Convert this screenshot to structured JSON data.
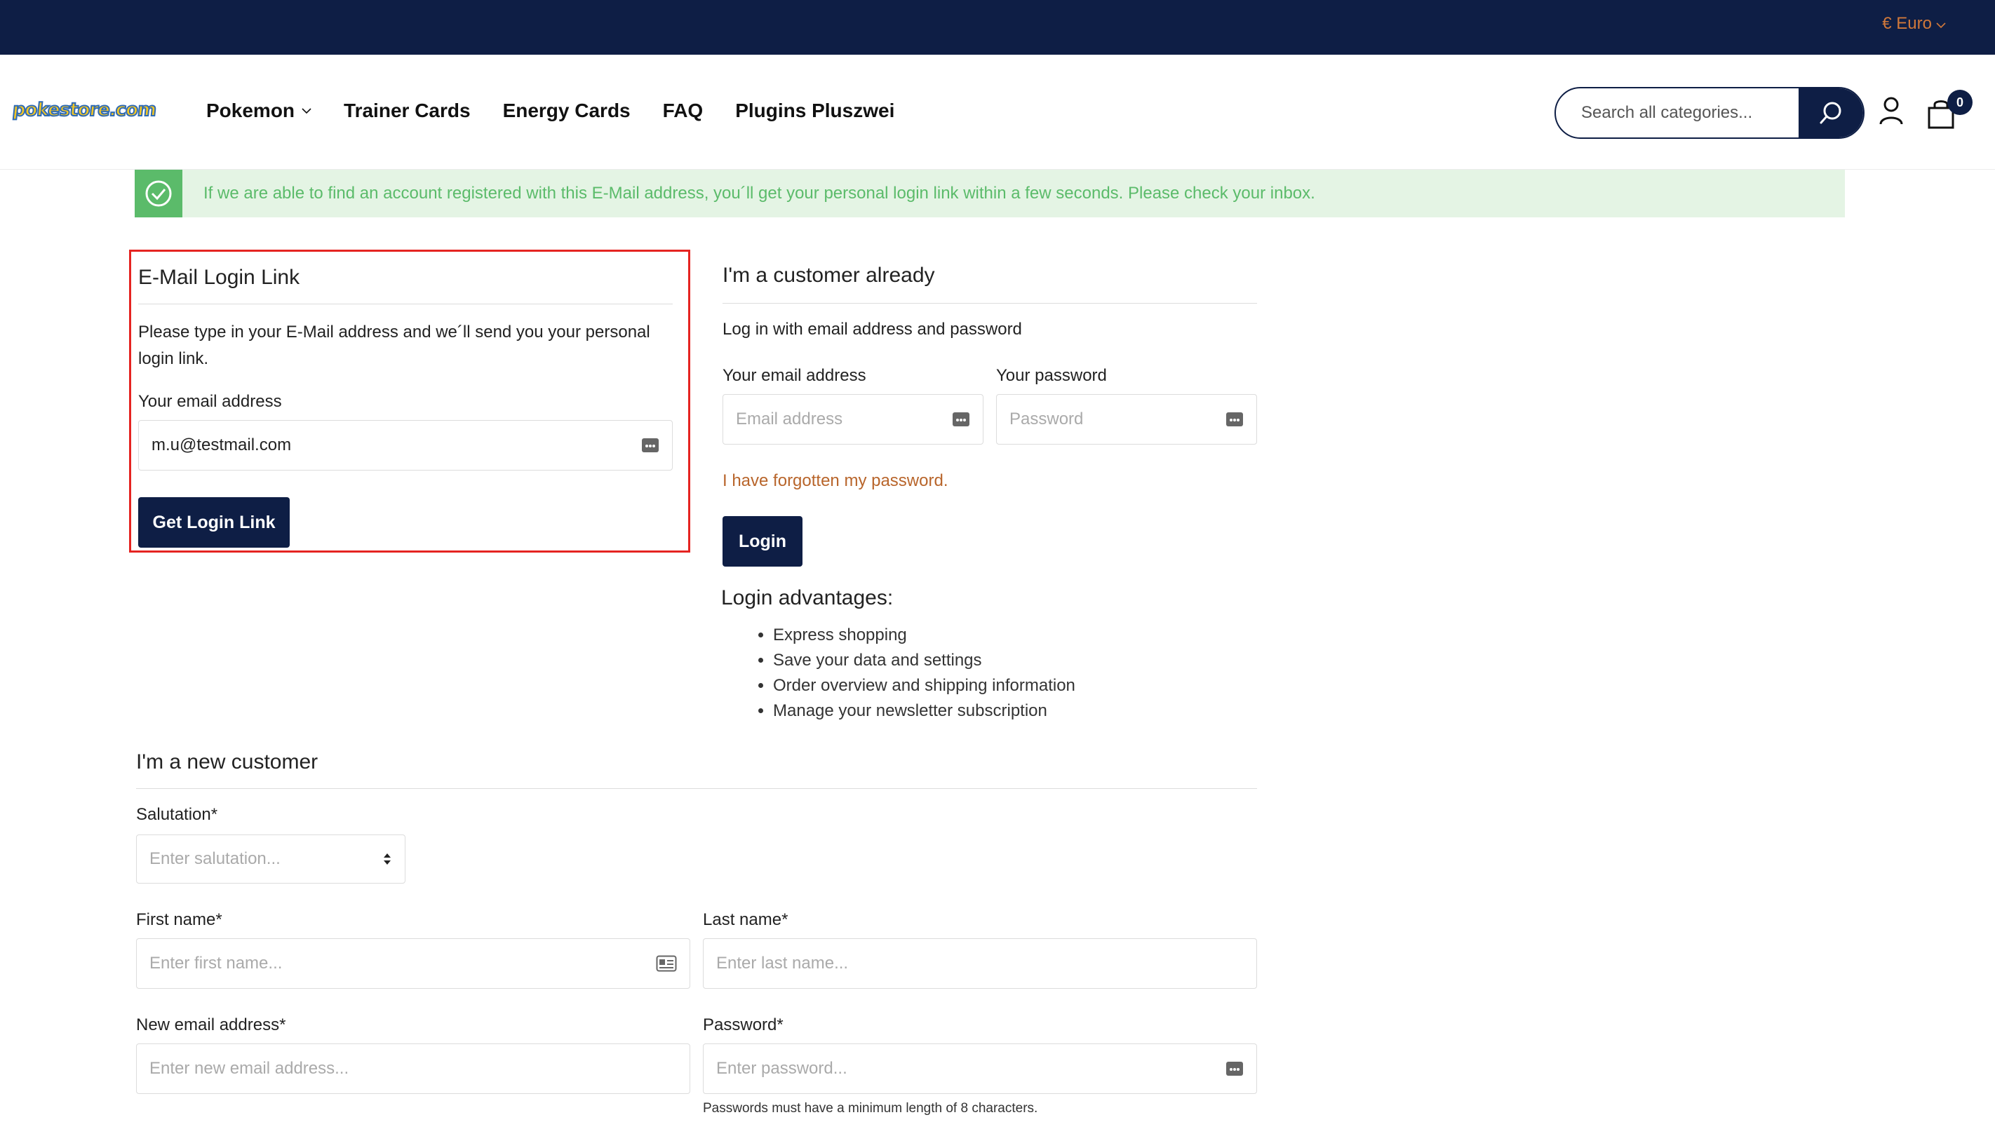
{
  "topbar": {
    "currency": "€ Euro"
  },
  "header": {
    "logo": "pokestore.com",
    "nav": [
      {
        "label": "Pokemon",
        "has_dropdown": true
      },
      {
        "label": "Trainer Cards"
      },
      {
        "label": "Energy Cards"
      },
      {
        "label": "FAQ"
      },
      {
        "label": "Plugins Pluszwei"
      }
    ],
    "search_placeholder": "Search all categories...",
    "cart_count": "0"
  },
  "alert": {
    "text": "If we are able to find an account registered with this E-Mail address, you´ll get your personal login link within a few seconds. Please check your inbox.",
    "color": "#5bbb6a"
  },
  "login_link": {
    "title": "E-Mail Login Link",
    "description": "Please type in your E-Mail address and we´ll send you your personal login link.",
    "email_label": "Your email address",
    "email_value": "m.u@testmail.com",
    "button": "Get Login Link"
  },
  "existing_customer": {
    "title": "I'm a customer already",
    "subtitle": "Log in with email address and password",
    "email_label": "Your email address",
    "email_placeholder": "Email address",
    "password_label": "Your password",
    "password_placeholder": "Password",
    "forgot_link": "I have forgotten my password.",
    "login_button": "Login",
    "advantages_title": "Login advantages:",
    "advantages": [
      "Express shopping",
      "Save your data and settings",
      "Order overview and shipping information",
      "Manage your newsletter subscription"
    ]
  },
  "new_customer": {
    "title": "I'm a new customer",
    "salutation_label": "Salutation*",
    "salutation_placeholder": "Enter salutation...",
    "first_name_label": "First name*",
    "first_name_placeholder": "Enter first name...",
    "last_name_label": "Last name*",
    "last_name_placeholder": "Enter last name...",
    "email_label": "New email address*",
    "email_placeholder": "Enter new email address...",
    "password_label": "Password*",
    "password_placeholder": "Enter password...",
    "password_hint": "Passwords must have a minimum length of 8 characters."
  },
  "colors": {
    "navy": "#0e1e45",
    "accent_orange": "#b8652b",
    "highlight_red": "#e52421",
    "success_green": "#5bbb6a"
  }
}
